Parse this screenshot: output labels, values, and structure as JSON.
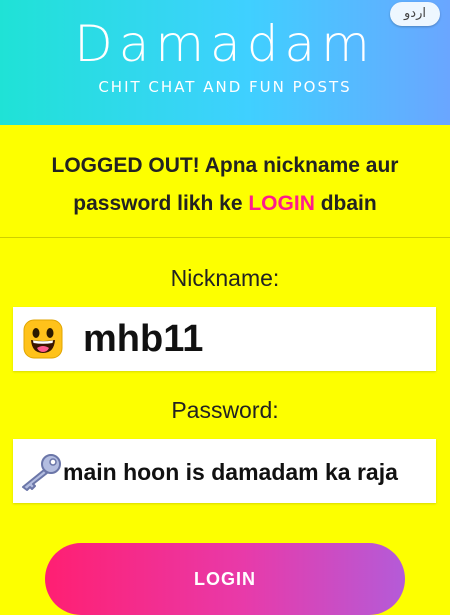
{
  "header": {
    "title": "Damadam",
    "tagline": "CHIT CHAT AND FUN POSTS",
    "language_button": "اردو",
    "gradient": [
      "#1fe2d6",
      "#6aa6ff"
    ]
  },
  "message": {
    "prefix": "LOGGED OUT! Apna nickname aur",
    "line2_before": "password likh ke",
    "highlight": "LOGIN",
    "line2_after": "dbain",
    "highlight_color": "#ff1c8d"
  },
  "form": {
    "nickname_label": "Nickname:",
    "nickname_value": "mhb11",
    "nickname_icon": "grinning-face-icon",
    "password_label": "Password:",
    "password_value": "main hoon is damadam ka raja",
    "password_icon": "key-icon",
    "submit_label": "LOGIN"
  },
  "colors": {
    "background": "#fdff00",
    "button_gradient": [
      "#ff1f72",
      "#b45bd8"
    ]
  }
}
